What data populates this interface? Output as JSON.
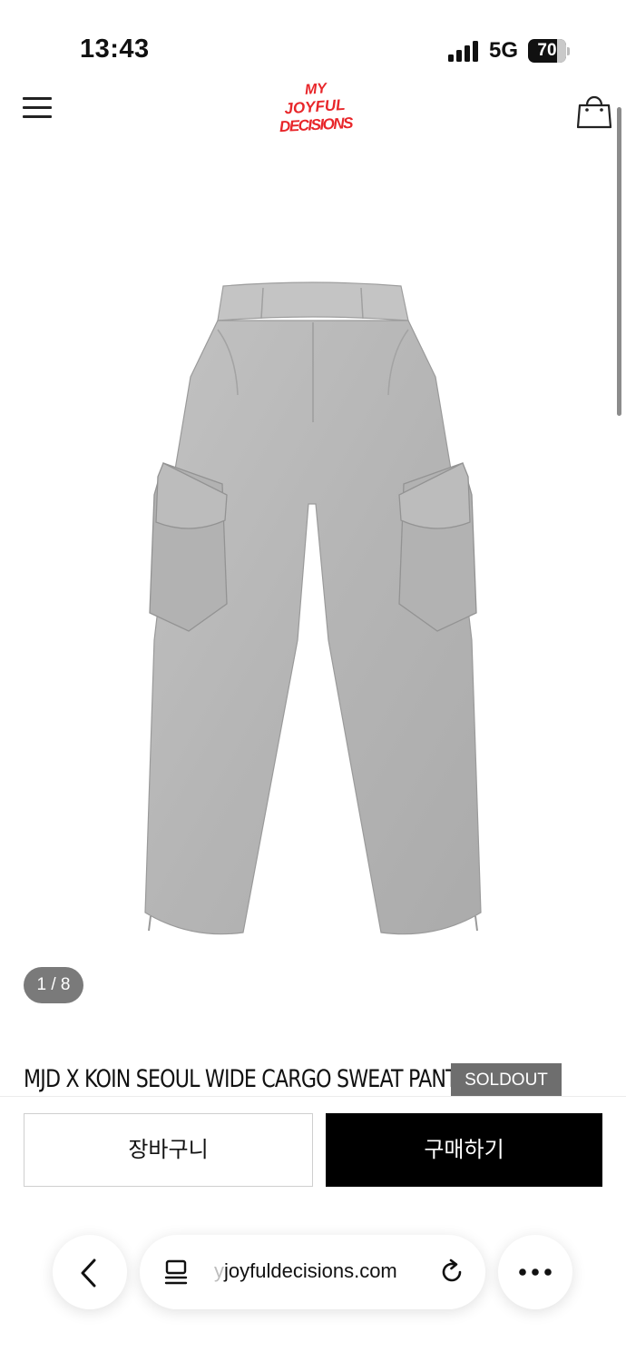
{
  "status_bar": {
    "time": "13:43",
    "network": "5G",
    "battery": "70"
  },
  "header": {
    "logo_lines": [
      "MY",
      "JOYFUL",
      "DECISIONS"
    ],
    "logo_color": "#e8262a",
    "menu_icon": "hamburger-menu-icon",
    "cart_icon": "shopping-bag-icon"
  },
  "gallery": {
    "counter": "1 / 8"
  },
  "product": {
    "title": "MJD X KOIN SEOUL WIDE CARGO SWEAT PANTS",
    "status_badge": "SOLDOUT"
  },
  "actions": {
    "cart_label": "장바구니",
    "buy_label": "구매하기"
  },
  "browser": {
    "url_faded": "y",
    "url": "joyfuldecisions.com",
    "back_icon": "chevron-left-icon",
    "page_icon": "page-menu-icon",
    "reload_icon": "reload-icon",
    "more_icon": "more-dots-icon"
  },
  "colors": {
    "accent": "#e8262a",
    "primary_button": "#000000",
    "badge": "#6e6e6e",
    "pants_gray": "#b8b8b8"
  }
}
